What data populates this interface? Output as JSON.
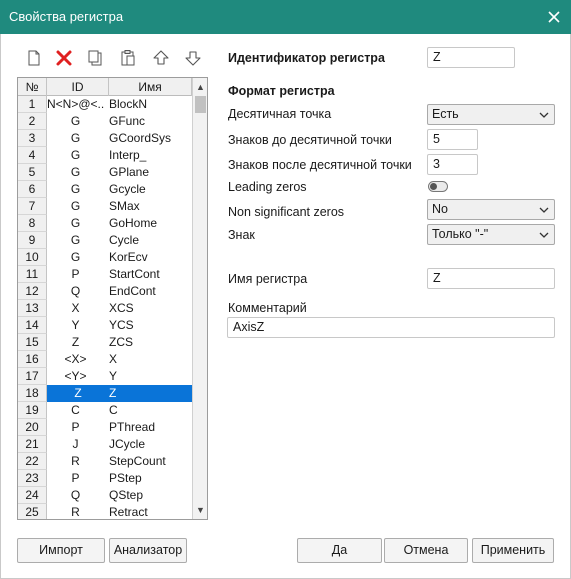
{
  "window": {
    "title": "Свойства регистра"
  },
  "table": {
    "headers": {
      "num": "№",
      "id": "ID",
      "name": "Имя"
    },
    "rows": [
      {
        "num": "1",
        "id": "N<N>@<...",
        "name": "BlockN"
      },
      {
        "num": "2",
        "id": "G",
        "name": "GFunc"
      },
      {
        "num": "3",
        "id": "G",
        "name": "GCoordSys"
      },
      {
        "num": "4",
        "id": "G",
        "name": "Interp_"
      },
      {
        "num": "5",
        "id": "G",
        "name": "GPlane"
      },
      {
        "num": "6",
        "id": "G",
        "name": "Gcycle"
      },
      {
        "num": "7",
        "id": "G",
        "name": "SMax"
      },
      {
        "num": "8",
        "id": "G",
        "name": "GoHome"
      },
      {
        "num": "9",
        "id": "G",
        "name": "Cycle"
      },
      {
        "num": "10",
        "id": "G",
        "name": "KorEcv"
      },
      {
        "num": "11",
        "id": "P",
        "name": "StartCont"
      },
      {
        "num": "12",
        "id": "Q",
        "name": "EndCont"
      },
      {
        "num": "13",
        "id": "X",
        "name": "XCS"
      },
      {
        "num": "14",
        "id": "Y",
        "name": "YCS"
      },
      {
        "num": "15",
        "id": "Z",
        "name": "ZCS"
      },
      {
        "num": "16",
        "id": "<X>",
        "name": "X"
      },
      {
        "num": "17",
        "id": "<Y>",
        "name": "Y"
      },
      {
        "num": "18",
        "id": "Z",
        "name": "Z",
        "selected": true
      },
      {
        "num": "19",
        "id": "C",
        "name": "C"
      },
      {
        "num": "20",
        "id": "P",
        "name": "PThread"
      },
      {
        "num": "21",
        "id": "J",
        "name": "JCycle"
      },
      {
        "num": "22",
        "id": "R",
        "name": "StepCount"
      },
      {
        "num": "23",
        "id": "P",
        "name": "PStep"
      },
      {
        "num": "24",
        "id": "Q",
        "name": "QStep"
      },
      {
        "num": "25",
        "id": "R",
        "name": "Retract"
      }
    ]
  },
  "form": {
    "identifier_label": "Идентификатор регистра",
    "identifier_value": "Z",
    "format_heading": "Формат регистра",
    "decimal_point_label": "Десятичная точка",
    "decimal_point_value": "Есть",
    "digits_before_label": "Знаков до десятичной точки",
    "digits_before_value": "5",
    "digits_after_label": "Знаков после десятичной точки",
    "digits_after_value": "3",
    "leading_zeros_label": "Leading zeros",
    "non_sig_zeros_label": "Non significant zeros",
    "non_sig_zeros_value": "No",
    "sign_label": "Знак",
    "sign_value": "Только \"-\"",
    "register_name_label": "Имя регистра",
    "register_name_value": "Z",
    "comment_label": "Комментарий",
    "comment_value": "AxisZ"
  },
  "buttons": {
    "import": "Импорт",
    "analyzer": "Анализатор",
    "ok": "Да",
    "cancel": "Отмена",
    "apply": "Применить"
  },
  "colors": {
    "titlebar": "#1f8a7e",
    "selection": "#0a74d8",
    "delete_icon": "#e02020"
  }
}
